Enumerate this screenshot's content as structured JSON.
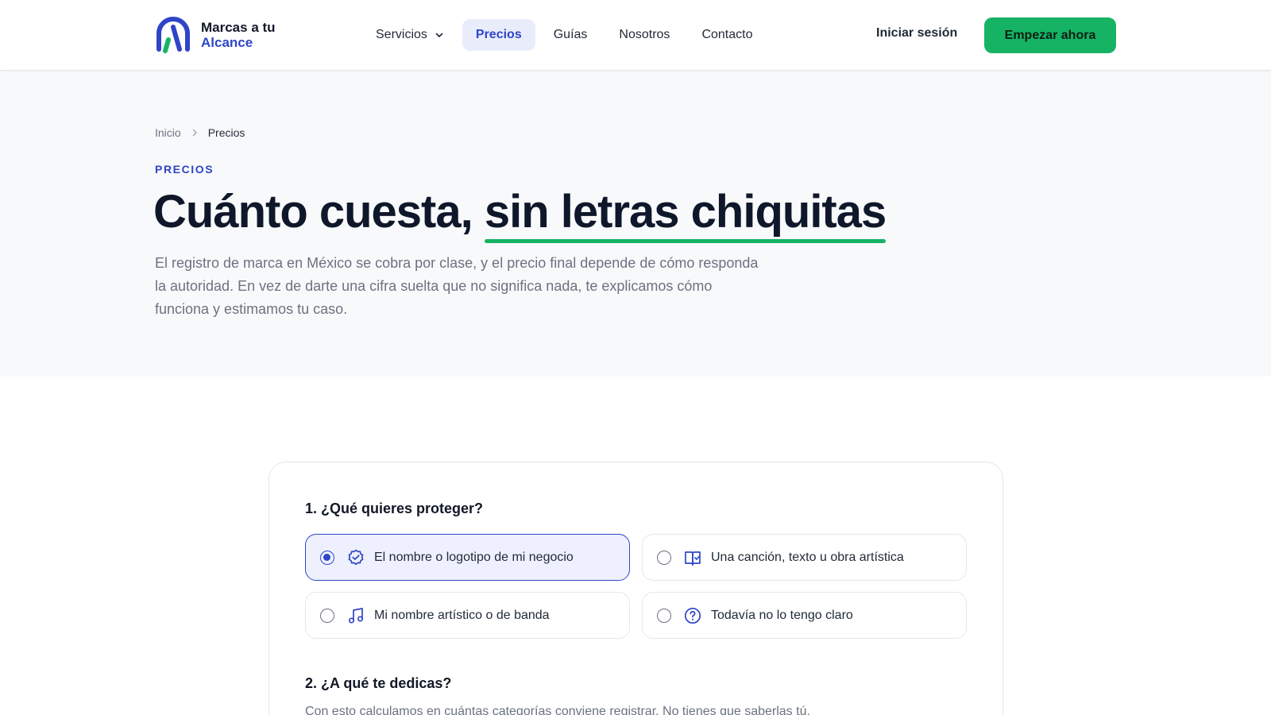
{
  "header": {
    "logo": {
      "line1": "Marcas a tu",
      "line2": "Alcance"
    },
    "nav": [
      {
        "label": "Servicios",
        "has_dropdown": true,
        "active": false
      },
      {
        "label": "Precios",
        "active": true
      },
      {
        "label": "Guías",
        "active": false
      },
      {
        "label": "Nosotros",
        "active": false
      },
      {
        "label": "Contacto",
        "active": false
      }
    ],
    "login_label": "Iniciar sesión",
    "cta_label": "Empezar ahora"
  },
  "hero": {
    "breadcrumb": {
      "home": "Inicio",
      "current": "Precios"
    },
    "eyebrow": "PRECIOS",
    "title_part1": "Cuánto cuesta, ",
    "title_highlight": "sin letras chiquitas",
    "lead": "El registro de marca en México se cobra por clase, y el precio final depende de cómo responda la autoridad. En vez de darte una cifra suelta que no significa nada, te explicamos cómo funciona y estimamos tu caso."
  },
  "quiz": {
    "q1": {
      "title": "1. ¿Qué quieres proteger?",
      "options": [
        {
          "label": "El nombre o logotipo de mi negocio",
          "icon": "badge-check-icon",
          "selected": true
        },
        {
          "label": "Una canción, texto u obra artística",
          "icon": "book-open-icon",
          "selected": false
        },
        {
          "label": "Mi nombre artístico o de banda",
          "icon": "music-note-icon",
          "selected": false
        },
        {
          "label": "Todavía no lo tengo claro",
          "icon": "question-circle-icon",
          "selected": false
        }
      ]
    },
    "q2": {
      "title": "2. ¿A qué te dedicas?",
      "subtitle": "Con esto calculamos en cuántas categorías conviene registrar. No tienes que saberlas tú."
    }
  },
  "colors": {
    "brand_blue": "#2f45c8",
    "brand_green": "#16b364",
    "hero_bg": "#f8f9fb",
    "selected_bg": "#eef1fd"
  }
}
